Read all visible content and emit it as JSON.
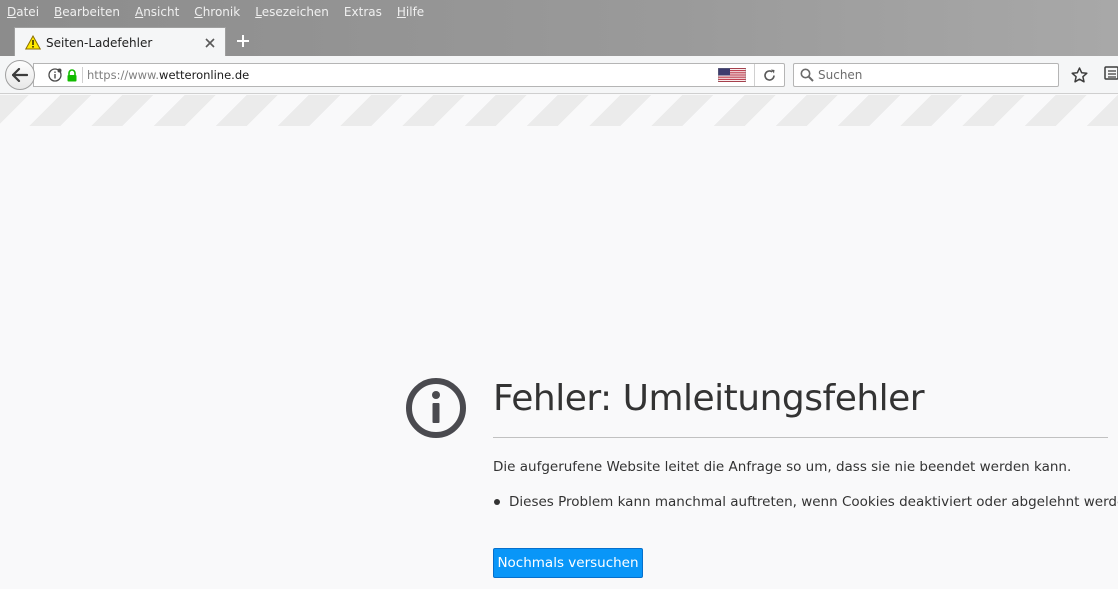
{
  "menubar": {
    "items": [
      {
        "mnemonic": "D",
        "rest": "atei"
      },
      {
        "mnemonic": "B",
        "rest": "earbeiten"
      },
      {
        "mnemonic": "A",
        "rest": "nsicht"
      },
      {
        "mnemonic": "C",
        "rest": "hronik"
      },
      {
        "mnemonic": "L",
        "rest": "esezeichen"
      },
      {
        "mnemonic": "E",
        "rest": "xtras",
        "prefix": ""
      },
      {
        "mnemonic": "H",
        "rest": "ilfe"
      }
    ]
  },
  "tab": {
    "title": "Seiten-Ladefehler",
    "icon": "warning-icon"
  },
  "urlbar": {
    "scheme": "https://www.",
    "host": "wetteronline.de"
  },
  "search": {
    "placeholder": "Suchen"
  },
  "error": {
    "title": "Fehler: Umleitungsfehler",
    "description": "Die aufgerufene Website leitet die Anfrage so um, dass sie nie beendet werden kann.",
    "bullet": "Dieses Problem kann manchmal auftreten, wenn Cookies deaktiviert oder abgelehnt werden.",
    "retry_label": "Nochmals versuchen"
  },
  "colors": {
    "accent": "#0996f8",
    "text": "#333333",
    "background": "#f9f9fa"
  }
}
